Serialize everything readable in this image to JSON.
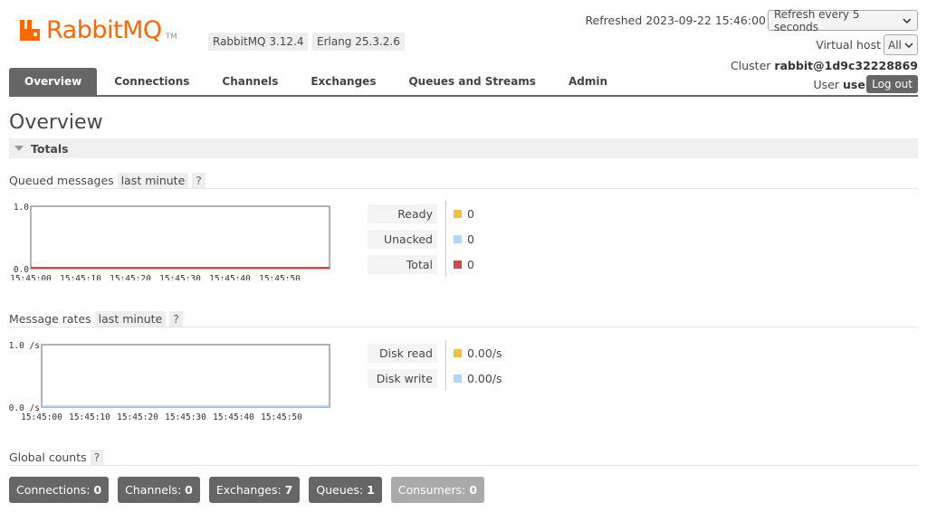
{
  "header": {
    "logo_text": "RabbitMQ",
    "logo_tm": "TM",
    "rabbitmq_version": "RabbitMQ 3.12.4",
    "erlang_version": "Erlang 25.3.2.6",
    "refreshed": "Refreshed 2023-09-22 15:46:00",
    "refresh_option": "Refresh every 5 seconds",
    "vhost_label": "Virtual host",
    "vhost_value": "All",
    "cluster_label": "Cluster",
    "cluster_name": "rabbit@1d9c32228869",
    "user_label": "User",
    "user_name": "user",
    "logout_label": "Log out",
    "brand_color": "#ff6600"
  },
  "tabs": [
    {
      "label": "Overview",
      "active": true
    },
    {
      "label": "Connections",
      "active": false
    },
    {
      "label": "Channels",
      "active": false
    },
    {
      "label": "Exchanges",
      "active": false
    },
    {
      "label": "Queues and Streams",
      "active": false
    },
    {
      "label": "Admin",
      "active": false
    }
  ],
  "main": {
    "title": "Overview",
    "totals_label": "Totals",
    "queued_messages": {
      "heading": "Queued messages",
      "range": "last minute",
      "help": "?",
      "legend": [
        {
          "label": "Ready",
          "value": "0",
          "color": "#edc240"
        },
        {
          "label": "Unacked",
          "value": "0",
          "color": "#afd8f8"
        },
        {
          "label": "Total",
          "value": "0",
          "color": "#cb4b4b"
        }
      ]
    },
    "message_rates": {
      "heading": "Message rates",
      "range": "last minute",
      "help": "?",
      "legend": [
        {
          "label": "Disk read",
          "value": "0.00/s",
          "color": "#edc240"
        },
        {
          "label": "Disk write",
          "value": "0.00/s",
          "color": "#afd8f8"
        }
      ]
    },
    "global_counts": {
      "heading": "Global counts",
      "help": "?",
      "items": [
        {
          "label": "Connections:",
          "value": "0",
          "dim": false
        },
        {
          "label": "Channels:",
          "value": "0",
          "dim": false
        },
        {
          "label": "Exchanges:",
          "value": "7",
          "dim": false
        },
        {
          "label": "Queues:",
          "value": "1",
          "dim": false
        },
        {
          "label": "Consumers:",
          "value": "0",
          "dim": true
        }
      ]
    }
  },
  "chart_data": [
    {
      "type": "line",
      "ylim": [
        0.0,
        1.0
      ],
      "y_tick_labels": [
        "1.0",
        "0.0"
      ],
      "x_tick_labels": [
        "15:45:00",
        "15:45:10",
        "15:45:20",
        "15:45:30",
        "15:45:40",
        "15:45:50"
      ],
      "series": [
        {
          "name": "Ready",
          "values": [
            0,
            0,
            0,
            0,
            0,
            0
          ],
          "color": "#edc240"
        },
        {
          "name": "Unacked",
          "values": [
            0,
            0,
            0,
            0,
            0,
            0
          ],
          "color": "#afd8f8"
        },
        {
          "name": "Total",
          "values": [
            0,
            0,
            0,
            0,
            0,
            0
          ],
          "color": "#cb4b4b"
        }
      ]
    },
    {
      "type": "line",
      "ylim": [
        0.0,
        1.0
      ],
      "y_tick_labels": [
        "1.0 /s",
        "0.0 /s"
      ],
      "x_tick_labels": [
        "15:45:00",
        "15:45:10",
        "15:45:20",
        "15:45:30",
        "15:45:40",
        "15:45:50"
      ],
      "series": [
        {
          "name": "Disk read",
          "values": [
            0,
            0,
            0,
            0,
            0,
            0
          ],
          "color": "#edc240"
        },
        {
          "name": "Disk write",
          "values": [
            0,
            0,
            0,
            0,
            0,
            0
          ],
          "color": "#afd8f8"
        }
      ]
    }
  ]
}
